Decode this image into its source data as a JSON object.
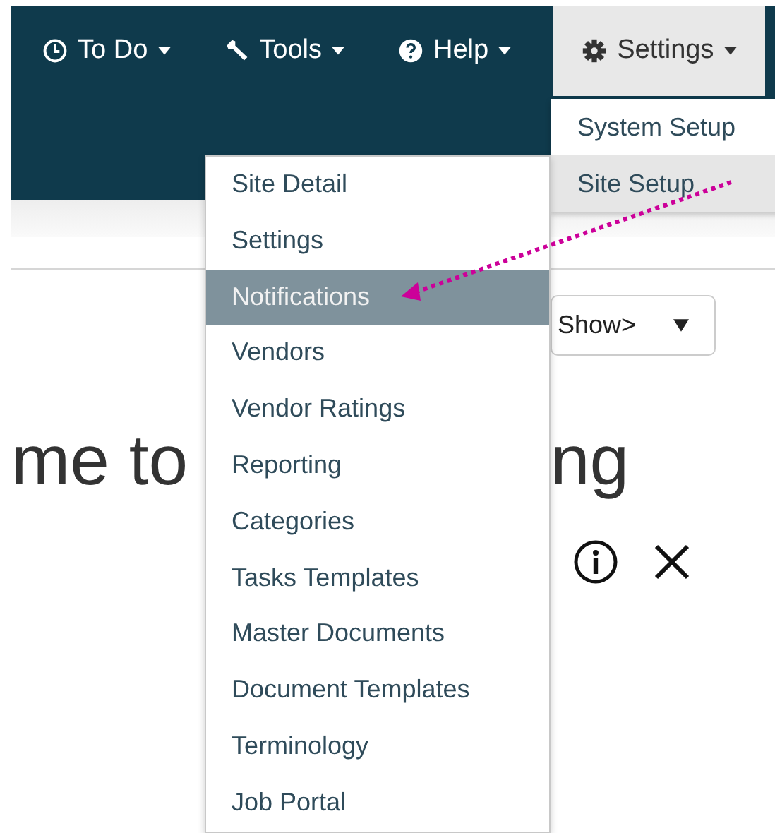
{
  "nav": [
    {
      "label": "To Do",
      "selected": false
    },
    {
      "label": "Tools",
      "selected": false
    },
    {
      "label": "Help",
      "selected": false
    },
    {
      "label": "Settings",
      "selected": true
    }
  ],
  "settings_menu": [
    {
      "label": "System Setup",
      "selected": false
    },
    {
      "label": "Site Setup",
      "selected": true
    }
  ],
  "site_setup_menu": [
    {
      "label": "Site Detail",
      "selected": false
    },
    {
      "label": "Settings",
      "selected": false
    },
    {
      "label": "Notifications",
      "selected": true
    },
    {
      "label": "Vendors",
      "selected": false
    },
    {
      "label": "Vendor Ratings",
      "selected": false
    },
    {
      "label": "Reporting",
      "selected": false
    },
    {
      "label": "Categories",
      "selected": false
    },
    {
      "label": "Tasks Templates",
      "selected": false
    },
    {
      "label": "Master Documents",
      "selected": false
    },
    {
      "label": "Document Templates",
      "selected": false
    },
    {
      "label": "Terminology",
      "selected": false
    },
    {
      "label": "Job Portal",
      "selected": false
    }
  ],
  "show_select": {
    "value": "Show>"
  },
  "heading": {
    "left_part": "me to",
    "right_part": "ng"
  }
}
